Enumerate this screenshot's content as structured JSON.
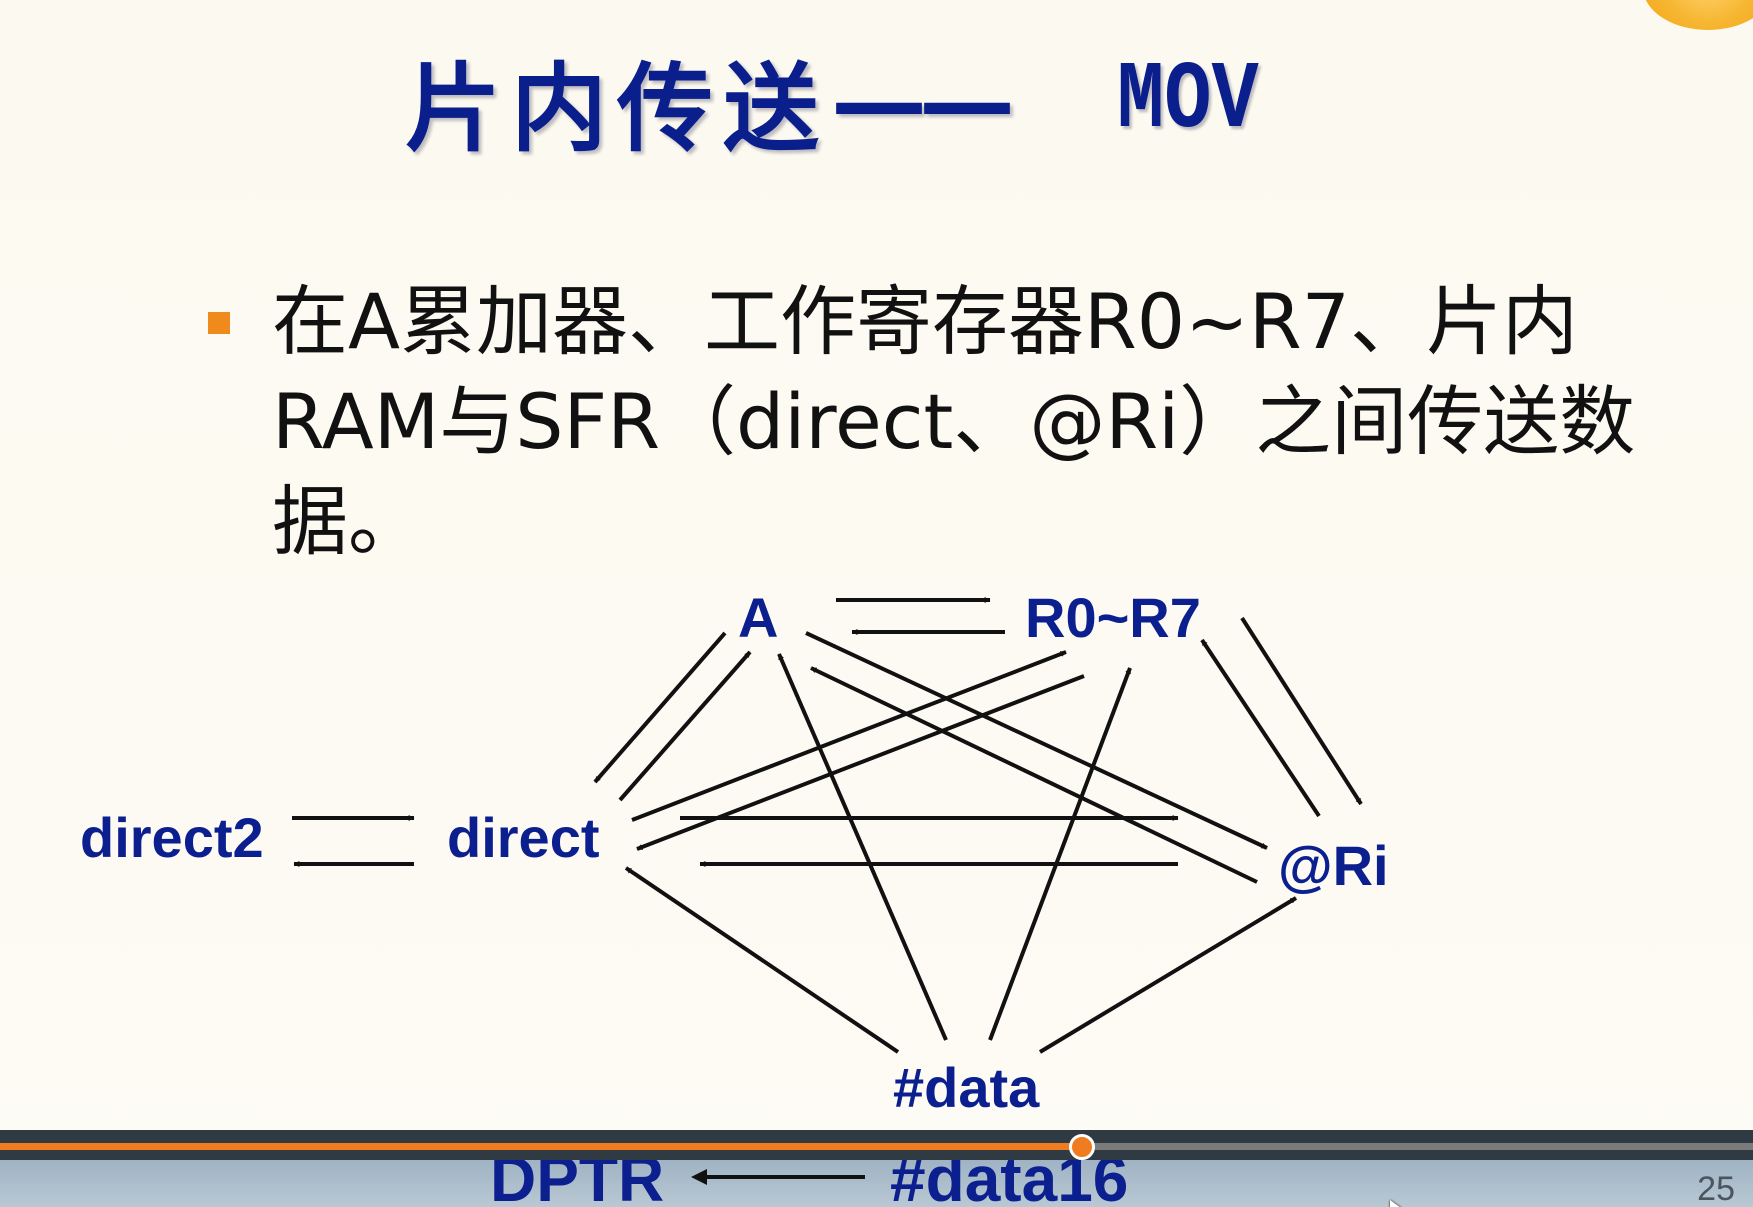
{
  "slide": {
    "title": {
      "chinese": "片内传送",
      "dash": "——",
      "mnemonic": "MOV"
    },
    "bullet": "在A累加器、工作寄存器R0~R7、片内RAM与SFR（direct、@Ri）之间传送数据。",
    "diagram": {
      "nodes": {
        "A": "A",
        "R": "R0~R7",
        "direct2": "direct2",
        "direct": "direct",
        "Ri": "@Ri",
        "data": "#data"
      }
    }
  },
  "player": {
    "peek_left": "DPTR",
    "peek_right": "#data16",
    "page_number": "25",
    "progress": 0.617,
    "accent_color": "#f07c21"
  }
}
